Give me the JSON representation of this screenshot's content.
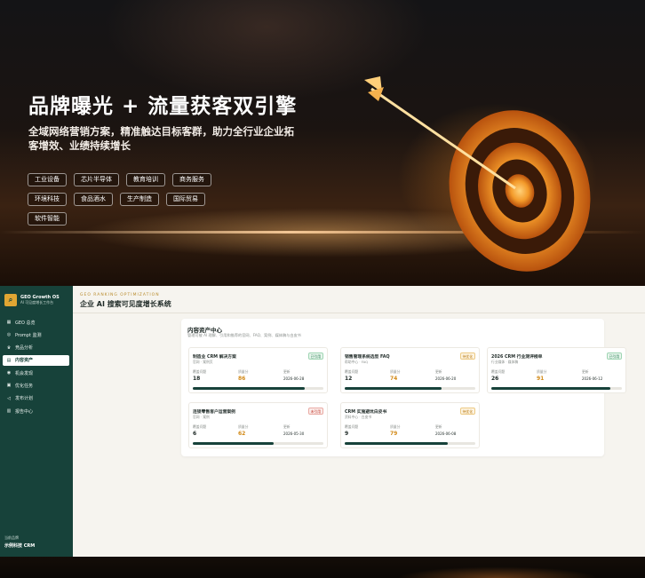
{
  "hero": {
    "title": "品牌曝光 + 流量获客双引擎",
    "subtitle": "全域网络营销方案，精准触达目标客群，助力全行业企业拓客增效、业绩持续增长",
    "tags": [
      "工业设备",
      "芯片半导体",
      "教育培训",
      "商务服务",
      "环境科技",
      "食品酒水",
      "生产制造",
      "国际贸易",
      "软件智能"
    ]
  },
  "sidebar": {
    "brand_name": "GEO Growth OS",
    "brand_sub": "AI 可见度增长工作台",
    "items": [
      {
        "label": "GEO 总览",
        "icon": "grid-icon"
      },
      {
        "label": "Prompt 监测",
        "icon": "search-icon"
      },
      {
        "label": "竞品分析",
        "icon": "trophy-icon"
      },
      {
        "label": "内容资产",
        "icon": "document-icon",
        "active": true
      },
      {
        "label": "机会发现",
        "icon": "compass-icon"
      },
      {
        "label": "优化任务",
        "icon": "clipboard-icon"
      },
      {
        "label": "发布计划",
        "icon": "megaphone-icon"
      },
      {
        "label": "报告中心",
        "icon": "chart-icon"
      }
    ],
    "footer_label": "当前品牌",
    "footer_value": "示例科技 CRM"
  },
  "header": {
    "eyebrow": "GEO RANKING OPTIMIZATION",
    "title": "企业 AI 搜索可见度增长系统"
  },
  "panel": {
    "title": "内容资产中心",
    "description": "管理可被 AI 理解、引用和推荐的官网、FAQ、案例、媒体稿与白皮书",
    "labels": {
      "coverage": "覆盖问题",
      "score": "质量分",
      "updated": "更新"
    },
    "cards": [
      {
        "title": "制造业 CRM 解决方案",
        "sub": "官网 · 案例页",
        "badge": "已引用",
        "badge_type": "green",
        "coverage": "18",
        "score": "86",
        "updated": "2026-06-28",
        "progress": 0.86
      },
      {
        "title": "销售管理系统选型 FAQ",
        "sub": "帮助中心 · FAQ",
        "badge": "待优化",
        "badge_type": "orange",
        "coverage": "12",
        "score": "74",
        "updated": "2026-06-20",
        "progress": 0.74
      },
      {
        "title": "2026 CRM 行业测评榜单",
        "sub": "行业媒体 · 媒体稿",
        "badge": "已引用",
        "badge_type": "green",
        "coverage": "26",
        "score": "91",
        "updated": "2026-06-12",
        "progress": 0.91
      },
      {
        "title": "连锁零售客户运营案例",
        "sub": "官网 · 案例",
        "badge": "未引用",
        "badge_type": "red",
        "coverage": "6",
        "score": "62",
        "updated": "2026-05-30",
        "progress": 0.62
      },
      {
        "title": "CRM 实施避坑白皮书",
        "sub": "资料中心 · 白皮书",
        "badge": "待优化",
        "badge_type": "orange",
        "coverage": "9",
        "score": "79",
        "updated": "2026-06-08",
        "progress": 0.79
      }
    ]
  },
  "colors": {
    "sidebar": "#17423a",
    "accent": "#e0a633",
    "score": "#d28a18"
  }
}
